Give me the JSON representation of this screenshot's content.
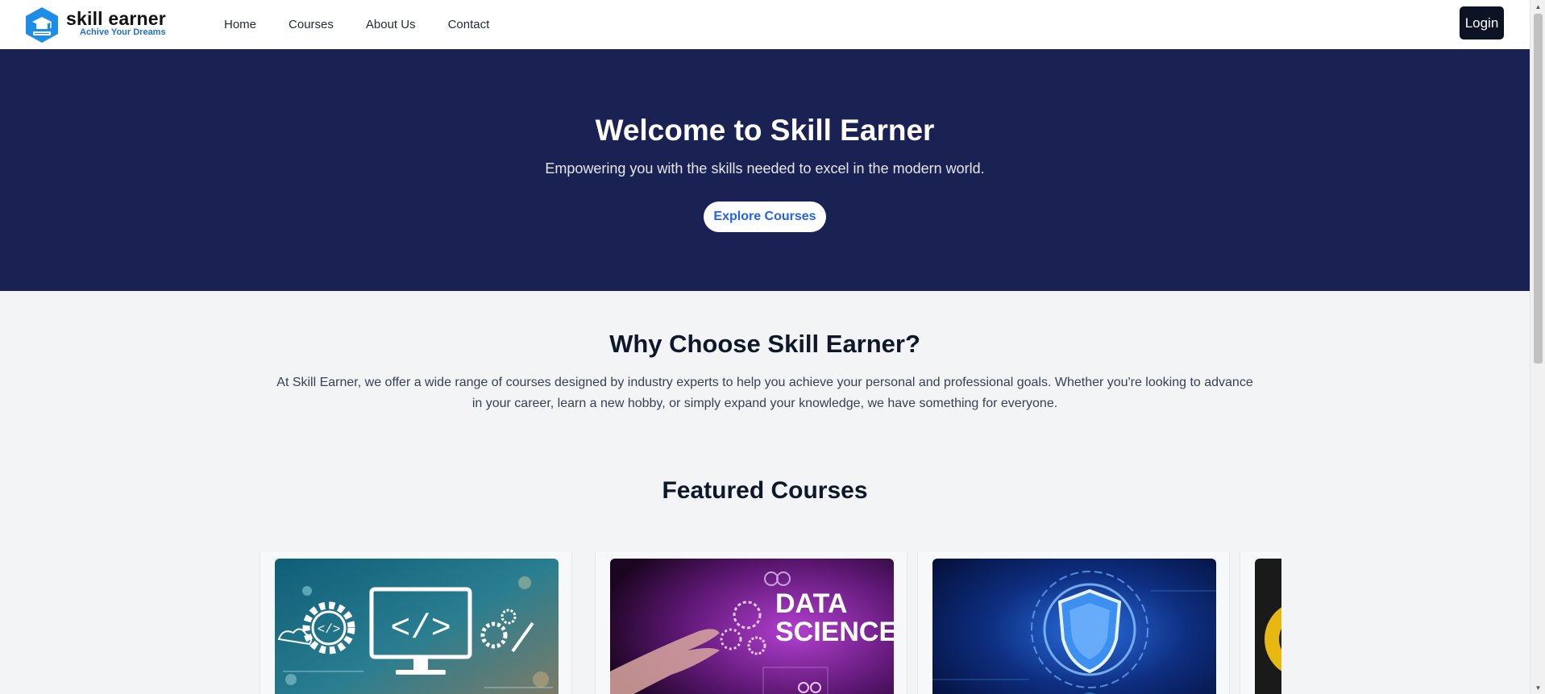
{
  "header": {
    "logo_name": "skill earner",
    "logo_tagline": "Achive Your Dreams",
    "nav": [
      {
        "label": "Home"
      },
      {
        "label": "Courses"
      },
      {
        "label": "About Us"
      },
      {
        "label": "Contact"
      }
    ],
    "login_label": "Login"
  },
  "hero": {
    "title": "Welcome to Skill Earner",
    "subtitle": "Empowering you with the skills needed to excel in the modern world.",
    "cta_label": "Explore Courses"
  },
  "why": {
    "title": "Why Choose Skill Earner?",
    "body": "At Skill Earner, we offer a wide range of courses designed by industry experts to help you achieve your personal and professional goals. Whether you're looking to advance in your career, learn a new hobby, or simply expand your knowledge, we have something for everyone."
  },
  "featured": {
    "title": "Featured Courses",
    "cards": [
      {
        "icon": "web-development-image"
      },
      {
        "icon": "data-science-image",
        "image_text_line1": "DATA",
        "image_text_line2": "SCIENCE"
      },
      {
        "icon": "cyber-security-image"
      },
      {
        "icon": "course-image-partial"
      }
    ]
  },
  "colors": {
    "hero_bg": "#1a2254",
    "cta_text": "#2563eb",
    "login_bg": "#0b1324",
    "logo_accent": "#1d6fd8",
    "page_bg": "#f3f4f6"
  }
}
